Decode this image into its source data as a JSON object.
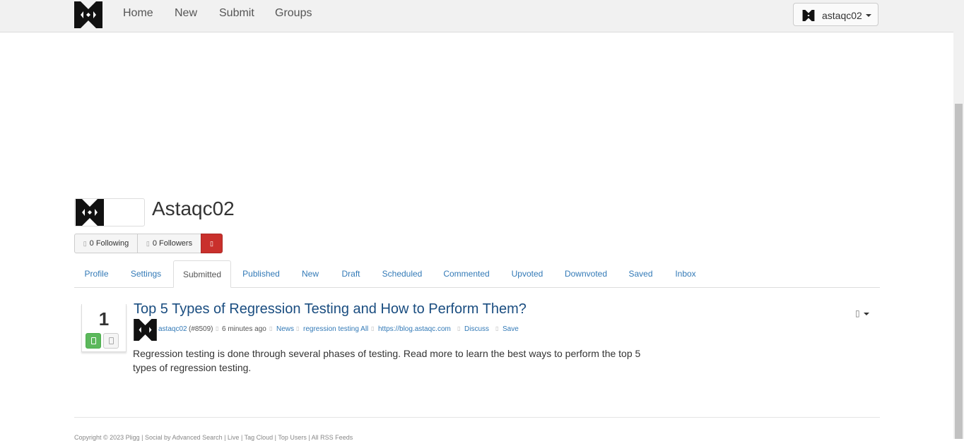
{
  "nav": {
    "links": [
      "Home",
      "New",
      "Submit",
      "Groups"
    ],
    "user": "astaqc02"
  },
  "profile": {
    "name": "Astaqc02",
    "following": "0 Following",
    "followers": "0 Followers"
  },
  "tabs": [
    "Profile",
    "Settings",
    "Submitted",
    "Published",
    "New",
    "Draft",
    "Scheduled",
    "Commented",
    "Upvoted",
    "Downvoted",
    "Saved",
    "Inbox"
  ],
  "active_tab": "Submitted",
  "post": {
    "votes": "1",
    "title": "Top 5 Types of Regression Testing and How to Perform Them?",
    "author": "astaqc02",
    "author_id": "(#8509)",
    "time": "6 minutes ago",
    "category": "News",
    "tags": "regression testing All",
    "domain": "https://blog.astaqc.com",
    "discuss": "Discuss",
    "save": "Save",
    "description": "Regression testing is done through several phases of testing. Read more to learn the best ways to perform the top 5 types of regression testing."
  },
  "footer": {
    "text": "Copyright © 2023 Pligg | Social by Advanced Search | Live | Tag Cloud | Top Users | All RSS Feeds"
  },
  "colors": {
    "navbar": "#f1f1f1",
    "link": "#337ab7",
    "title": "#1a4d80",
    "upvote": "#5cb85c",
    "follow_red": "#c9302c"
  }
}
